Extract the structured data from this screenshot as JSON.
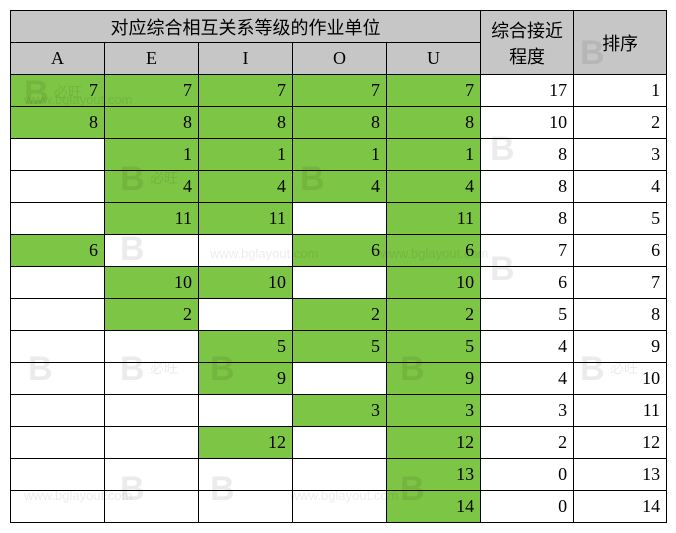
{
  "headers": {
    "group_title": "对应综合相互关系等级的作业单位",
    "cols": [
      "A",
      "E",
      "I",
      "O",
      "U"
    ],
    "proximity": "综合接近\n程度",
    "rank": "排序"
  },
  "chart_data": {
    "type": "table",
    "columns": [
      "A",
      "E",
      "I",
      "O",
      "U",
      "综合接近程度",
      "排序"
    ],
    "rows": [
      {
        "A": 7,
        "E": 7,
        "I": 7,
        "O": 7,
        "U": 7,
        "prox": 17,
        "rank": 1,
        "hl": [
          "A",
          "E",
          "I",
          "O",
          "U"
        ]
      },
      {
        "A": 8,
        "E": 8,
        "I": 8,
        "O": 8,
        "U": 8,
        "prox": 10,
        "rank": 2,
        "hl": [
          "A",
          "E",
          "I",
          "O",
          "U"
        ]
      },
      {
        "A": "",
        "E": 1,
        "I": 1,
        "O": 1,
        "U": 1,
        "prox": 8,
        "rank": 3,
        "hl": [
          "E",
          "I",
          "O",
          "U"
        ]
      },
      {
        "A": "",
        "E": 4,
        "I": 4,
        "O": 4,
        "U": 4,
        "prox": 8,
        "rank": 4,
        "hl": [
          "E",
          "I",
          "O",
          "U"
        ]
      },
      {
        "A": "",
        "E": 11,
        "I": 11,
        "O": "",
        "U": 11,
        "prox": 8,
        "rank": 5,
        "hl": [
          "E",
          "I",
          "U"
        ]
      },
      {
        "A": 6,
        "E": "",
        "I": "",
        "O": 6,
        "U": 6,
        "prox": 7,
        "rank": 6,
        "hl": [
          "A",
          "O",
          "U"
        ]
      },
      {
        "A": "",
        "E": 10,
        "I": 10,
        "O": "",
        "U": 10,
        "prox": 6,
        "rank": 7,
        "hl": [
          "E",
          "I",
          "U"
        ]
      },
      {
        "A": "",
        "E": 2,
        "I": "",
        "O": 2,
        "U": 2,
        "prox": 5,
        "rank": 8,
        "hl": [
          "E",
          "O",
          "U"
        ]
      },
      {
        "A": "",
        "E": "",
        "I": 5,
        "O": 5,
        "U": 5,
        "prox": 4,
        "rank": 9,
        "hl": [
          "I",
          "O",
          "U"
        ]
      },
      {
        "A": "",
        "E": "",
        "I": 9,
        "O": "",
        "U": 9,
        "prox": 4,
        "rank": 10,
        "hl": [
          "I",
          "U"
        ]
      },
      {
        "A": "",
        "E": "",
        "I": "",
        "O": 3,
        "U": 3,
        "prox": 3,
        "rank": 11,
        "hl": [
          "O",
          "U"
        ]
      },
      {
        "A": "",
        "E": "",
        "I": 12,
        "O": "",
        "U": 12,
        "prox": 2,
        "rank": 12,
        "hl": [
          "I",
          "U"
        ]
      },
      {
        "A": "",
        "E": "",
        "I": "",
        "O": "",
        "U": 13,
        "prox": 0,
        "rank": 13,
        "hl": [
          "U"
        ]
      },
      {
        "A": "",
        "E": "",
        "I": "",
        "O": "",
        "U": 14,
        "prox": 0,
        "rank": 14,
        "hl": [
          "U"
        ]
      }
    ]
  },
  "watermark": {
    "logo": "B",
    "text": "必旺",
    "url": "www.bglayout.com"
  }
}
